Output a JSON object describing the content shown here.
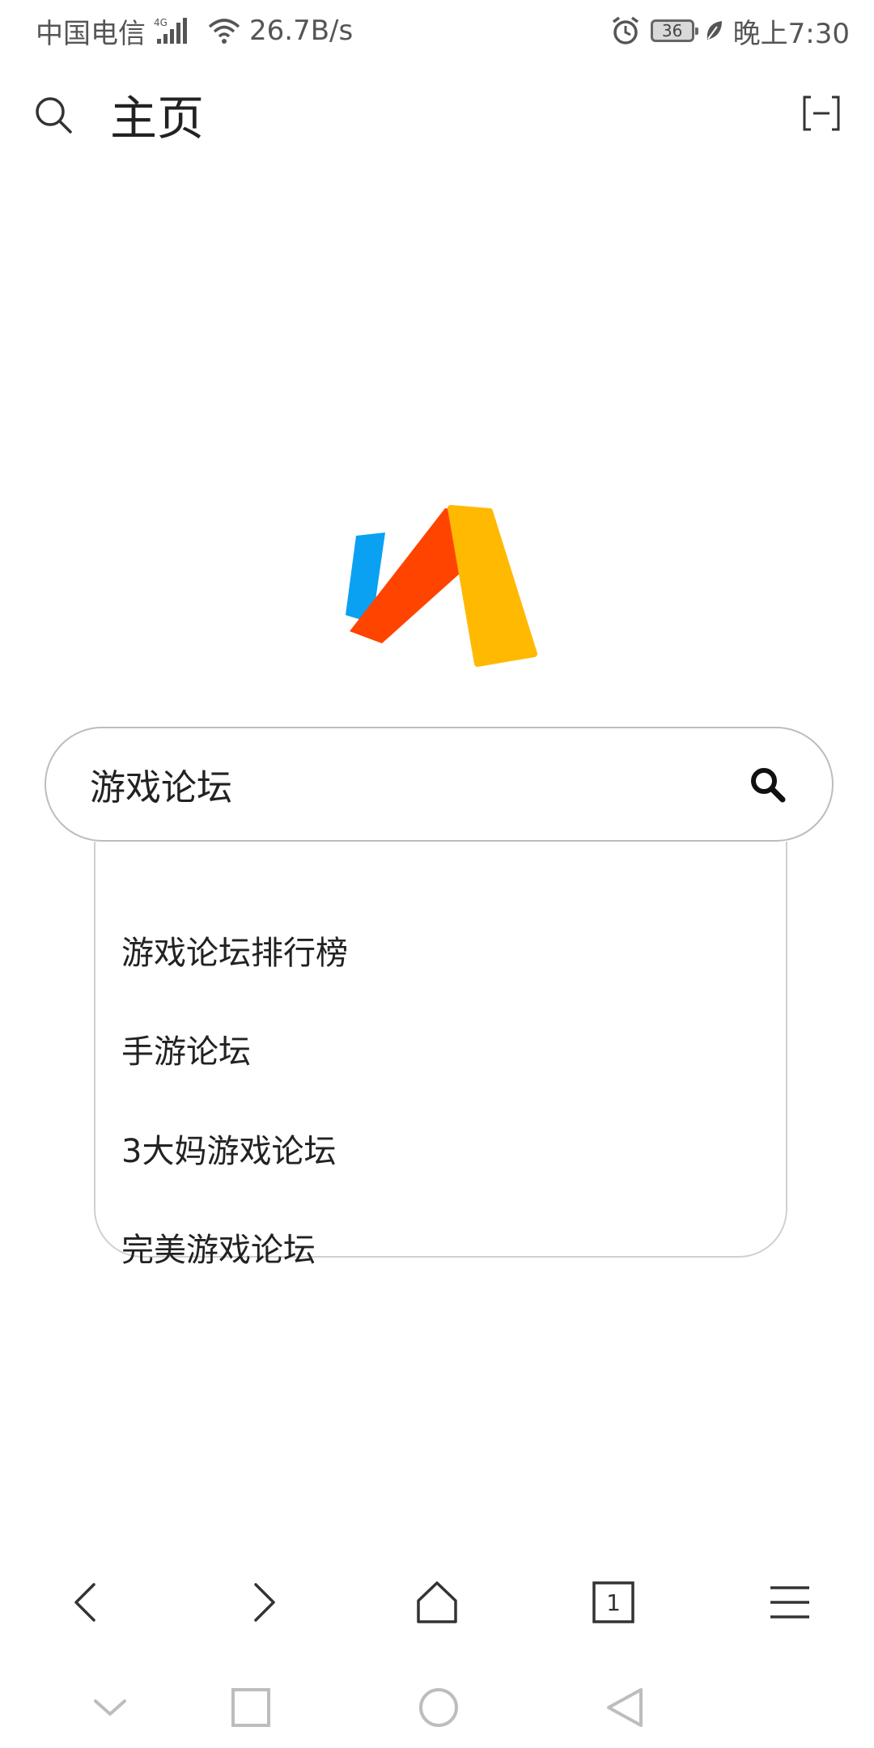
{
  "status_bar": {
    "carrier": "中国电信",
    "network_type": "4G",
    "net_speed": "26.7B/s",
    "battery": "36",
    "time": "晚上7:30",
    "icons": [
      "signal-icon",
      "wifi-icon",
      "alarm-icon",
      "battery-icon",
      "leaf-icon"
    ]
  },
  "header": {
    "title": "主页",
    "icons": [
      "search-icon",
      "fullscreen-icon"
    ]
  },
  "logo": {
    "colors": {
      "blue": "#0AA1F2",
      "red": "#FF4400",
      "yellow": "#FFB900"
    }
  },
  "search": {
    "value": "游戏论坛",
    "button_icon": "search-icon"
  },
  "suggestions": [
    "游戏论坛排行榜",
    "手游论坛",
    "3大妈游戏论坛",
    "完美游戏论坛"
  ],
  "browser_nav": {
    "tab_count": "1",
    "icons": [
      "back-icon",
      "forward-icon",
      "home-icon",
      "tabs-icon",
      "menu-icon"
    ]
  },
  "system_nav": {
    "icons": [
      "collapse-icon",
      "recents-icon",
      "home-circle-icon",
      "back-triangle-icon"
    ]
  },
  "colors": {
    "text": "#222222",
    "status_text": "#555555",
    "border": "#bdbdbd"
  }
}
